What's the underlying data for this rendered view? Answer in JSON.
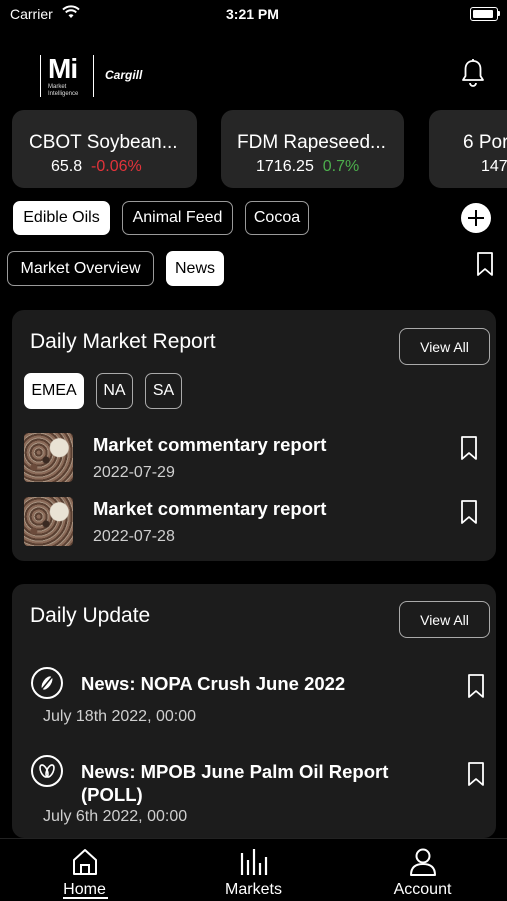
{
  "status_bar": {
    "carrier": "Carrier",
    "time": "3:21 PM"
  },
  "header": {
    "logo_mark": "Mi",
    "logo_sub_line1": "Market",
    "logo_sub_line2": "Intelligence",
    "partner_logo": "Cargill"
  },
  "tickers": [
    {
      "name": "CBOT Soybean...",
      "price": "65.8",
      "change": "-0.06%",
      "direction": "down"
    },
    {
      "name": "FDM Rapeseed...",
      "price": "1716.25",
      "change": "0.7%",
      "direction": "up"
    },
    {
      "name": "6 Por",
      "price": "147",
      "change": "",
      "direction": ""
    }
  ],
  "categories": [
    {
      "label": "Edible Oils",
      "selected": true
    },
    {
      "label": "Animal Feed",
      "selected": false
    },
    {
      "label": "Cocoa",
      "selected": false
    }
  ],
  "view_tabs": [
    {
      "label": "Market Overview",
      "selected": false
    },
    {
      "label": "News",
      "selected": true
    }
  ],
  "daily_report": {
    "title": "Daily Market Report",
    "view_all": "View All",
    "regions": [
      {
        "label": "EMEA",
        "selected": true
      },
      {
        "label": "NA",
        "selected": false
      },
      {
        "label": "SA",
        "selected": false
      }
    ],
    "items": [
      {
        "title": "Market commentary report",
        "date": "2022-07-29"
      },
      {
        "title": "Market commentary report",
        "date": "2022-07-28"
      }
    ]
  },
  "daily_update": {
    "title": "Daily Update",
    "view_all": "View All",
    "items": [
      {
        "title": "News: NOPA Crush June 2022",
        "date": "July 18th 2022, 00:00",
        "icon": "soybean-icon"
      },
      {
        "title": "News: MPOB June Palm Oil Report (POLL)",
        "date": "July 6th 2022, 00:00",
        "icon": "palm-fruit-icon"
      }
    ]
  },
  "tabbar": [
    {
      "label": "Home",
      "icon": "home-icon",
      "active": true
    },
    {
      "label": "Markets",
      "icon": "bar-chart-icon",
      "active": false
    },
    {
      "label": "Account",
      "icon": "person-icon",
      "active": false
    }
  ],
  "colors": {
    "negative": "#e2333a",
    "positive": "#4cae4c",
    "panel": "#1c1c1c",
    "card": "#262626"
  }
}
